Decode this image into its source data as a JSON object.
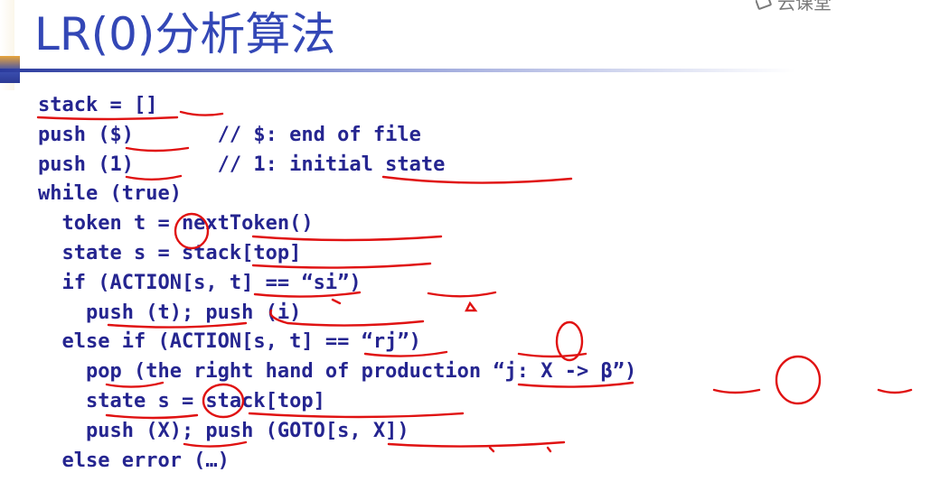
{
  "slide": {
    "title": "LR(0)分析算法",
    "watermark_text": "云课堂",
    "code_lines": [
      "stack = []",
      "push ($)       // $: end of file",
      "push (1)       // 1: initial state",
      "while (true)",
      "  token t = nextToken()",
      "  state s = stack[top]",
      "  if (ACTION[s, t] == “si”)",
      "    push (t); push (i)",
      "  else if (ACTION[s, t] == “rj”)",
      "    pop (the right hand of production “j: X -> β”)",
      "    state s = stack[top]",
      "    push (X); push (GOTO[s, X])",
      "  else error (…)"
    ]
  },
  "colors": {
    "title": "#3347b6",
    "code": "#252590",
    "annotation": "#e01212"
  },
  "icons": [
    "cloud-classroom-logo-icon"
  ]
}
